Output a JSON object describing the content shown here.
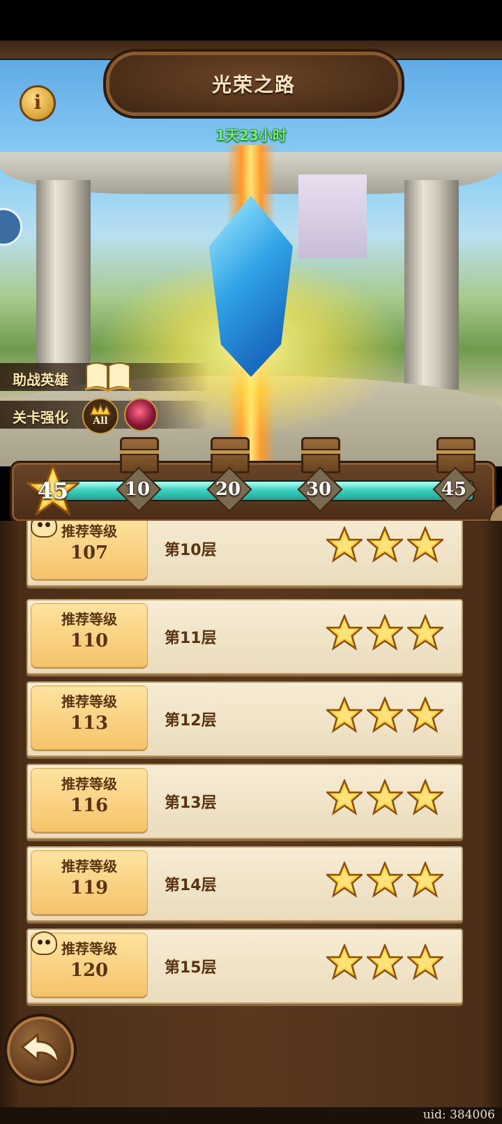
{
  "header": {
    "title": "光荣之路",
    "timer": "1天23小时"
  },
  "side_panel": {
    "assist_heroes_label": "助战英雄",
    "stage_buff_label": "关卡强化",
    "crown_badge_text": "All"
  },
  "progress": {
    "current_stars": "45",
    "max_stars": 45,
    "fraction": 1.0,
    "milestones": [
      {
        "label": "10"
      },
      {
        "label": "20"
      },
      {
        "label": "30"
      },
      {
        "label": "45"
      }
    ]
  },
  "floors": [
    {
      "level_label": "推荐等级",
      "level": "107",
      "name": "第10层",
      "stars": 3
    },
    {
      "level_label": "推荐等级",
      "level": "110",
      "name": "第11层",
      "stars": 3
    },
    {
      "level_label": "推荐等级",
      "level": "113",
      "name": "第12层",
      "stars": 3
    },
    {
      "level_label": "推荐等级",
      "level": "116",
      "name": "第13层",
      "stars": 3
    },
    {
      "level_label": "推荐等级",
      "level": "119",
      "name": "第14层",
      "stars": 3
    },
    {
      "level_label": "推荐等级",
      "level": "120",
      "name": "第15层",
      "stars": 3
    }
  ],
  "footer": {
    "uid": "uid: 384006"
  },
  "colors": {
    "timer_green": "#6cf26a",
    "progress_teal": "#3fd3c2",
    "star_gold": "#ffc928",
    "text_brown": "#5a3412"
  },
  "icons": {
    "info": "info-icon",
    "book": "book-icon",
    "crown": "crown-icon",
    "buff": "buff-icon",
    "chest": "chest-icon",
    "star": "star-icon",
    "skull": "skull-icon",
    "back": "back-arrow-icon"
  }
}
